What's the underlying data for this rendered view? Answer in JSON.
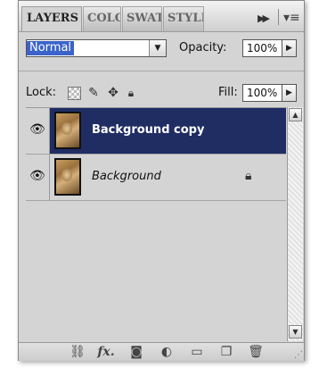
{
  "tabs": [
    {
      "label": "LAYERS",
      "active": true
    },
    {
      "label": "COLO",
      "active": false
    },
    {
      "label": "SWAT",
      "active": false
    },
    {
      "label": "STYLE",
      "active": false
    }
  ],
  "tab_icons": {
    "expand": "double-chevron-right-icon",
    "menu": "panel-menu-icon"
  },
  "blend_mode": {
    "value": "Normal"
  },
  "opacity": {
    "label": "Opacity:",
    "value": "100%"
  },
  "lock": {
    "label": "Lock:",
    "icons": [
      "lock-transparent-pixels-icon",
      "lock-image-pixels-icon",
      "lock-position-icon",
      "lock-all-icon"
    ]
  },
  "fill": {
    "label": "Fill:",
    "value": "100%"
  },
  "layers": [
    {
      "name": "Background copy",
      "visible": true,
      "selected": true,
      "locked": false
    },
    {
      "name": "Background",
      "visible": true,
      "selected": false,
      "locked": true
    }
  ],
  "footer_icons": [
    "link-layers-icon",
    "layer-style-fx-icon",
    "add-mask-icon",
    "adjustment-layer-icon",
    "new-group-icon",
    "new-layer-icon",
    "delete-layer-icon"
  ],
  "footer_labels": {
    "fx": "fx."
  },
  "colors": {
    "selected_row": "#1f2d63",
    "selection_highlight": "#3b63c9",
    "panel_bg": "#d4d4d4"
  }
}
